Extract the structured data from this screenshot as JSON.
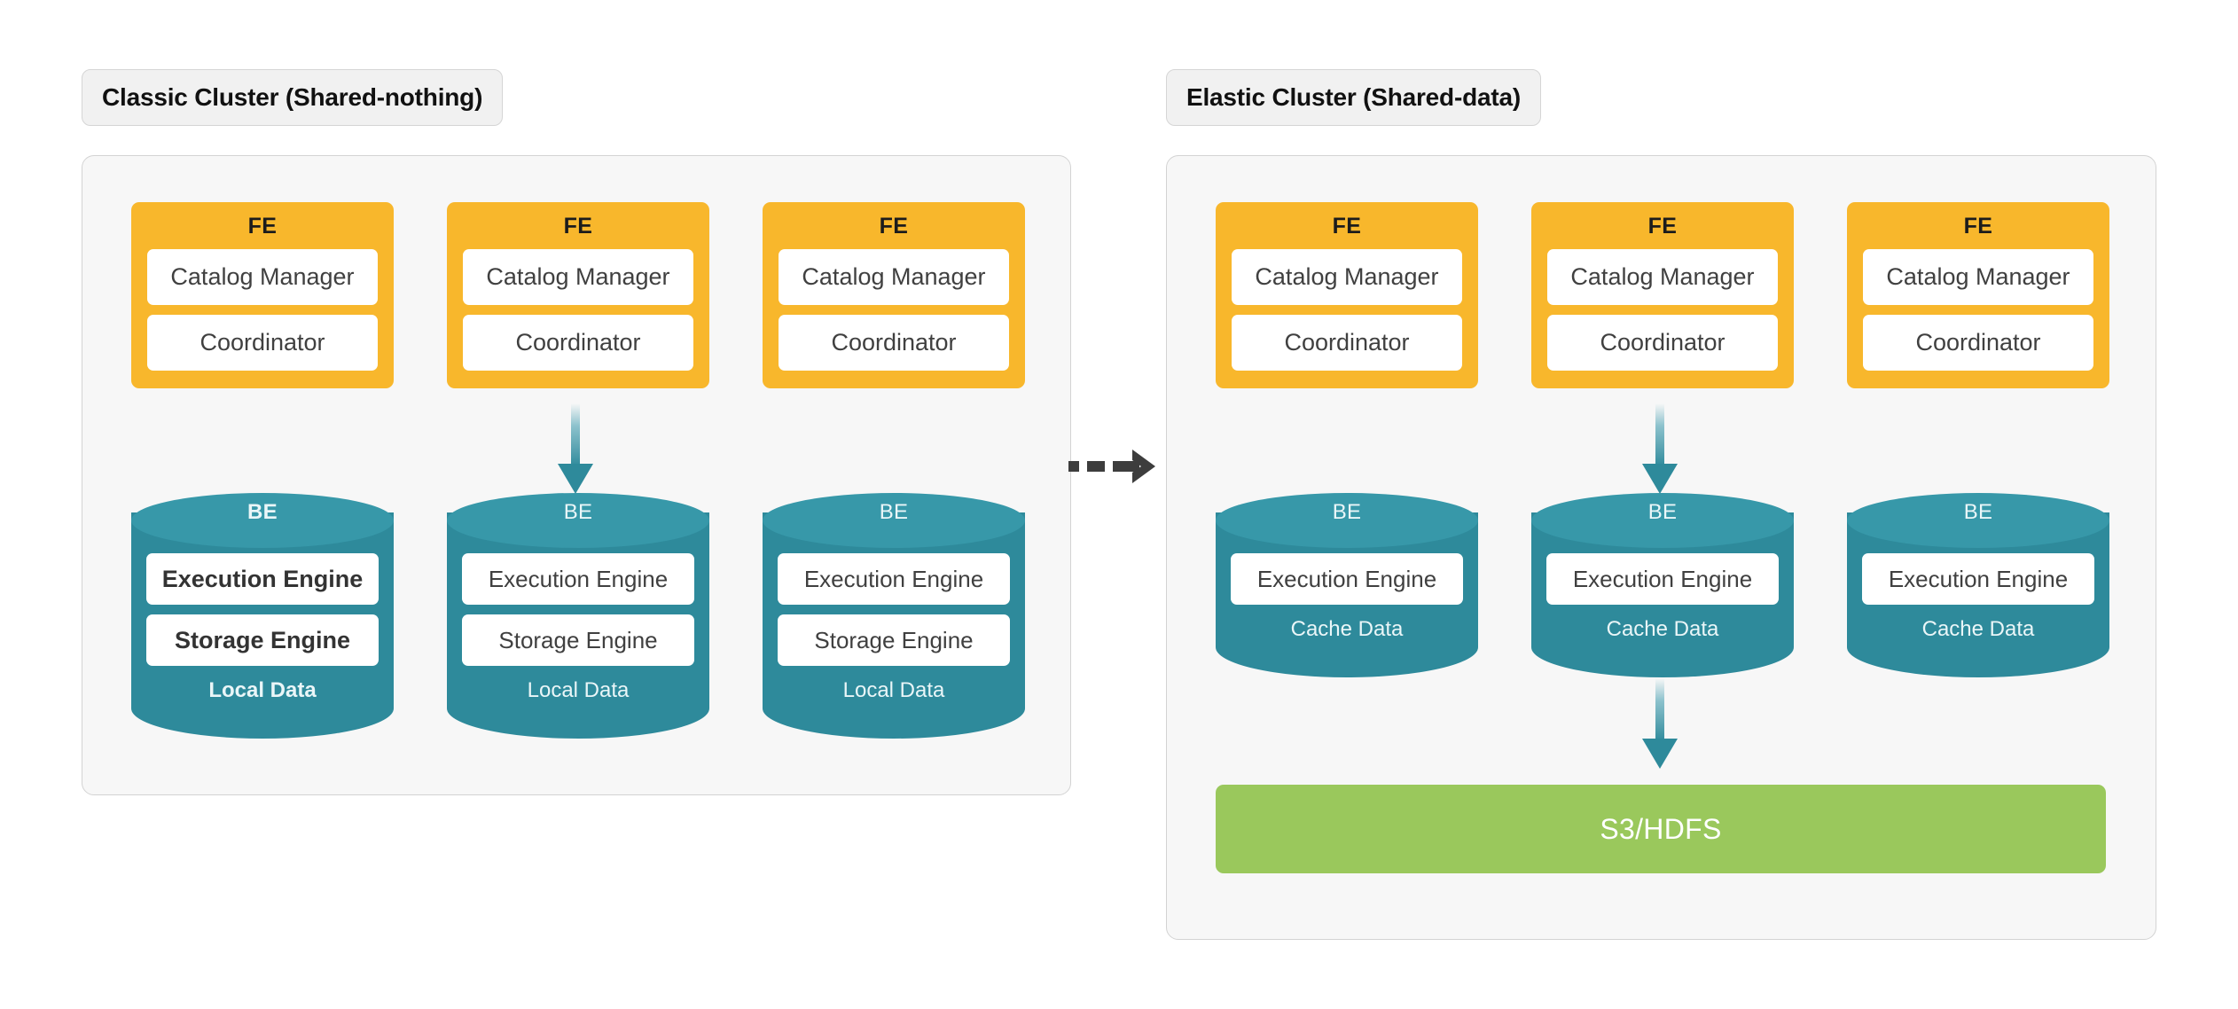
{
  "diagram": {
    "title_classic": "Classic Cluster (Shared-nothing)",
    "title_elastic": "Elastic Cluster (Shared-data)",
    "transition_arrow": "dashed-arrow-right"
  },
  "colors": {
    "fe_orange": "#F8B72C",
    "be_teal_body": "#2E8A9B",
    "be_teal_cap": "#3798A9",
    "storage_green": "#9AC85C",
    "panel_bg": "#F7F7F7",
    "panel_border": "#D3D3D3",
    "pill_bg": "#F1F1F1",
    "arrow_gray": "#3D3D3D"
  },
  "classic_cluster": {
    "fe_nodes": [
      {
        "header": "FE",
        "sub": [
          "Catalog Manager",
          "Coordinator"
        ]
      },
      {
        "header": "FE",
        "sub": [
          "Catalog Manager",
          "Coordinator"
        ]
      },
      {
        "header": "FE",
        "sub": [
          "Catalog Manager",
          "Coordinator"
        ]
      }
    ],
    "be_nodes": [
      {
        "header": "BE",
        "sub": [
          "Execution Engine",
          "Storage Engine"
        ],
        "footer": "Local Data"
      },
      {
        "header": "BE",
        "sub": [
          "Execution Engine",
          "Storage Engine"
        ],
        "footer": "Local Data"
      },
      {
        "header": "BE",
        "sub": [
          "Execution Engine",
          "Storage Engine"
        ],
        "footer": "Local Data"
      }
    ]
  },
  "elastic_cluster": {
    "fe_nodes": [
      {
        "header": "FE",
        "sub": [
          "Catalog Manager",
          "Coordinator"
        ]
      },
      {
        "header": "FE",
        "sub": [
          "Catalog Manager",
          "Coordinator"
        ]
      },
      {
        "header": "FE",
        "sub": [
          "Catalog Manager",
          "Coordinator"
        ]
      }
    ],
    "be_nodes": [
      {
        "header": "BE",
        "sub": [
          "Execution Engine"
        ],
        "footer": "Cache Data"
      },
      {
        "header": "BE",
        "sub": [
          "Execution Engine"
        ],
        "footer": "Cache Data"
      },
      {
        "header": "BE",
        "sub": [
          "Execution Engine"
        ],
        "footer": "Cache Data"
      }
    ],
    "storage": {
      "label": "S3/HDFS"
    }
  }
}
